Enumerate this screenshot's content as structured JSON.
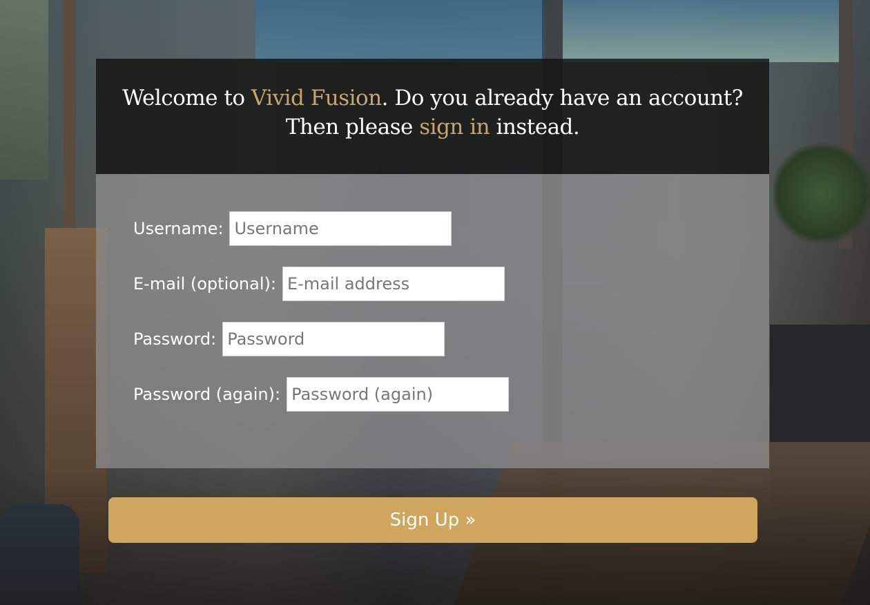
{
  "header": {
    "welcome_prefix": "Welcome to ",
    "brand": "Vivid Fusion",
    "welcome_middle": ". Do you already have an account? Then please ",
    "signin_link": "sign in",
    "welcome_suffix": " instead."
  },
  "form": {
    "username": {
      "label": "Username:",
      "placeholder": "Username",
      "value": ""
    },
    "email": {
      "label": "E-mail (optional):",
      "placeholder": "E-mail address",
      "value": ""
    },
    "password": {
      "label": "Password:",
      "placeholder": "Password",
      "value": ""
    },
    "password_again": {
      "label": "Password (again):",
      "placeholder": "Password (again)",
      "value": ""
    }
  },
  "submit": {
    "label": "Sign Up »"
  },
  "colors": {
    "accent": "#c9a46c",
    "button": "#d0a55e"
  }
}
